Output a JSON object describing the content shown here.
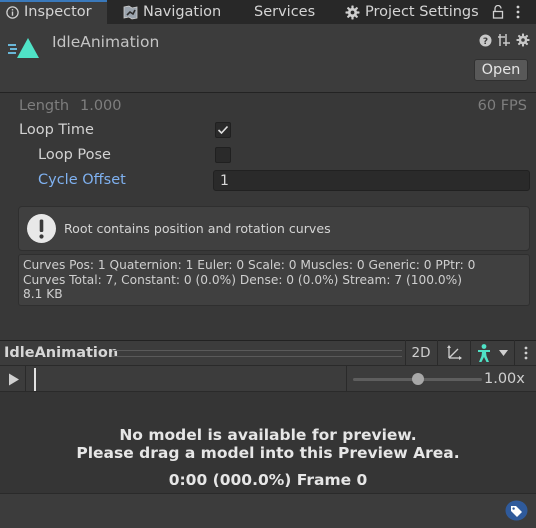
{
  "tabs": [
    {
      "label": "Inspector",
      "icon": "info-icon",
      "active": true
    },
    {
      "label": "Navigation",
      "icon": "navigation-icon",
      "active": false
    },
    {
      "label": "Services",
      "icon": "",
      "active": false
    },
    {
      "label": "Project Settings",
      "icon": "gear-icon",
      "active": false
    }
  ],
  "header": {
    "clip_name": "IdleAnimation",
    "open_label": "Open",
    "icons": [
      "help-icon",
      "preset-icon",
      "settings-icon",
      "lock-icon",
      "kebab-menu-icon"
    ]
  },
  "properties": {
    "length_label": "Length",
    "length_value": "1.000",
    "fps": "60 FPS",
    "loop_time_label": "Loop Time",
    "loop_time_checked": true,
    "loop_pose_label": "Loop Pose",
    "loop_pose_checked": false,
    "cycle_offset_label": "Cycle Offset",
    "cycle_offset_value": "1"
  },
  "help_box": {
    "icon": "warning-exclamation-icon",
    "message": "Root contains position and rotation curves"
  },
  "info_box": {
    "line1": "Curves Pos: 1 Quaternion: 1 Euler: 0 Scale: 0 Muscles: 0 Generic: 0 PPtr: 0",
    "line2": "Curves Total: 7, Constant: 0 (0.0%) Dense: 0 (0.0%) Stream: 7 (100.0%)",
    "line3": "8.1 KB"
  },
  "preview": {
    "title": "IdleAnimation",
    "mode_2d": "2D",
    "speed": "1.00x",
    "speed_fraction": 0.5,
    "message_line1": "No model is available for preview.",
    "message_line2": "Please drag a model into this Preview Area.",
    "frame_info": "0:00 (000.0%) Frame 0"
  },
  "colors": {
    "accent_blue": "#3a79bb",
    "link_blue": "#7fb1f0",
    "avatar_teal": "#4fe3c7"
  }
}
